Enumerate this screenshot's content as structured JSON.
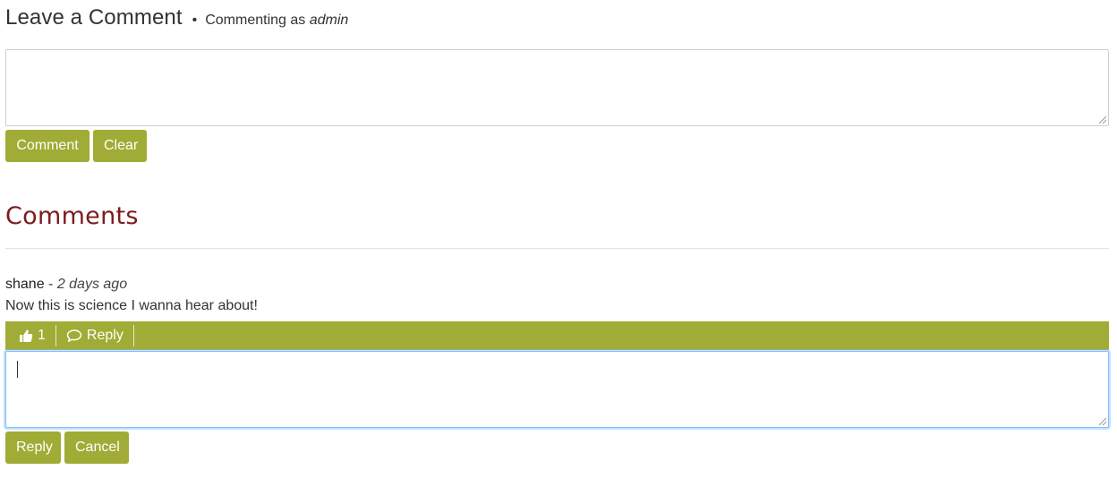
{
  "leave_comment": {
    "title": "Leave a Comment",
    "separator": "•",
    "commenting_as_prefix": "Commenting as",
    "commenting_as_user": "admin",
    "textarea_value": "",
    "comment_button": "Comment",
    "clear_button": "Clear"
  },
  "comments": {
    "heading": "Comments",
    "items": [
      {
        "author": "shane",
        "separator": " - ",
        "time": "2 days ago",
        "body": "Now this is science I wanna hear about!",
        "like_icon": "thumbs-up-icon",
        "like_count": "1",
        "reply_icon": "speech-bubble-icon",
        "reply_label": "Reply"
      }
    ]
  },
  "reply_form": {
    "textarea_value": "",
    "reply_button": "Reply",
    "cancel_button": "Cancel"
  },
  "colors": {
    "accent": "#a0ac35",
    "heading": "#7b1c1f",
    "focus": "#80bdff"
  }
}
